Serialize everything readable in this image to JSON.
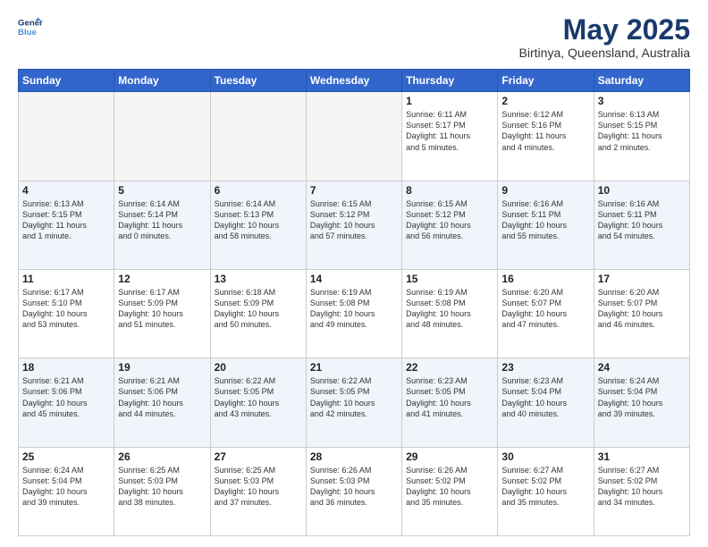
{
  "logo": {
    "line1": "General",
    "line2": "Blue"
  },
  "title": "May 2025",
  "location": "Birtinya, Queensland, Australia",
  "weekdays": [
    "Sunday",
    "Monday",
    "Tuesday",
    "Wednesday",
    "Thursday",
    "Friday",
    "Saturday"
  ],
  "weeks": [
    [
      {
        "day": "",
        "info": ""
      },
      {
        "day": "",
        "info": ""
      },
      {
        "day": "",
        "info": ""
      },
      {
        "day": "",
        "info": ""
      },
      {
        "day": "1",
        "info": "Sunrise: 6:11 AM\nSunset: 5:17 PM\nDaylight: 11 hours\nand 5 minutes."
      },
      {
        "day": "2",
        "info": "Sunrise: 6:12 AM\nSunset: 5:16 PM\nDaylight: 11 hours\nand 4 minutes."
      },
      {
        "day": "3",
        "info": "Sunrise: 6:13 AM\nSunset: 5:15 PM\nDaylight: 11 hours\nand 2 minutes."
      }
    ],
    [
      {
        "day": "4",
        "info": "Sunrise: 6:13 AM\nSunset: 5:15 PM\nDaylight: 11 hours\nand 1 minute."
      },
      {
        "day": "5",
        "info": "Sunrise: 6:14 AM\nSunset: 5:14 PM\nDaylight: 11 hours\nand 0 minutes."
      },
      {
        "day": "6",
        "info": "Sunrise: 6:14 AM\nSunset: 5:13 PM\nDaylight: 10 hours\nand 58 minutes."
      },
      {
        "day": "7",
        "info": "Sunrise: 6:15 AM\nSunset: 5:12 PM\nDaylight: 10 hours\nand 57 minutes."
      },
      {
        "day": "8",
        "info": "Sunrise: 6:15 AM\nSunset: 5:12 PM\nDaylight: 10 hours\nand 56 minutes."
      },
      {
        "day": "9",
        "info": "Sunrise: 6:16 AM\nSunset: 5:11 PM\nDaylight: 10 hours\nand 55 minutes."
      },
      {
        "day": "10",
        "info": "Sunrise: 6:16 AM\nSunset: 5:11 PM\nDaylight: 10 hours\nand 54 minutes."
      }
    ],
    [
      {
        "day": "11",
        "info": "Sunrise: 6:17 AM\nSunset: 5:10 PM\nDaylight: 10 hours\nand 53 minutes."
      },
      {
        "day": "12",
        "info": "Sunrise: 6:17 AM\nSunset: 5:09 PM\nDaylight: 10 hours\nand 51 minutes."
      },
      {
        "day": "13",
        "info": "Sunrise: 6:18 AM\nSunset: 5:09 PM\nDaylight: 10 hours\nand 50 minutes."
      },
      {
        "day": "14",
        "info": "Sunrise: 6:19 AM\nSunset: 5:08 PM\nDaylight: 10 hours\nand 49 minutes."
      },
      {
        "day": "15",
        "info": "Sunrise: 6:19 AM\nSunset: 5:08 PM\nDaylight: 10 hours\nand 48 minutes."
      },
      {
        "day": "16",
        "info": "Sunrise: 6:20 AM\nSunset: 5:07 PM\nDaylight: 10 hours\nand 47 minutes."
      },
      {
        "day": "17",
        "info": "Sunrise: 6:20 AM\nSunset: 5:07 PM\nDaylight: 10 hours\nand 46 minutes."
      }
    ],
    [
      {
        "day": "18",
        "info": "Sunrise: 6:21 AM\nSunset: 5:06 PM\nDaylight: 10 hours\nand 45 minutes."
      },
      {
        "day": "19",
        "info": "Sunrise: 6:21 AM\nSunset: 5:06 PM\nDaylight: 10 hours\nand 44 minutes."
      },
      {
        "day": "20",
        "info": "Sunrise: 6:22 AM\nSunset: 5:05 PM\nDaylight: 10 hours\nand 43 minutes."
      },
      {
        "day": "21",
        "info": "Sunrise: 6:22 AM\nSunset: 5:05 PM\nDaylight: 10 hours\nand 42 minutes."
      },
      {
        "day": "22",
        "info": "Sunrise: 6:23 AM\nSunset: 5:05 PM\nDaylight: 10 hours\nand 41 minutes."
      },
      {
        "day": "23",
        "info": "Sunrise: 6:23 AM\nSunset: 5:04 PM\nDaylight: 10 hours\nand 40 minutes."
      },
      {
        "day": "24",
        "info": "Sunrise: 6:24 AM\nSunset: 5:04 PM\nDaylight: 10 hours\nand 39 minutes."
      }
    ],
    [
      {
        "day": "25",
        "info": "Sunrise: 6:24 AM\nSunset: 5:04 PM\nDaylight: 10 hours\nand 39 minutes."
      },
      {
        "day": "26",
        "info": "Sunrise: 6:25 AM\nSunset: 5:03 PM\nDaylight: 10 hours\nand 38 minutes."
      },
      {
        "day": "27",
        "info": "Sunrise: 6:25 AM\nSunset: 5:03 PM\nDaylight: 10 hours\nand 37 minutes."
      },
      {
        "day": "28",
        "info": "Sunrise: 6:26 AM\nSunset: 5:03 PM\nDaylight: 10 hours\nand 36 minutes."
      },
      {
        "day": "29",
        "info": "Sunrise: 6:26 AM\nSunset: 5:02 PM\nDaylight: 10 hours\nand 35 minutes."
      },
      {
        "day": "30",
        "info": "Sunrise: 6:27 AM\nSunset: 5:02 PM\nDaylight: 10 hours\nand 35 minutes."
      },
      {
        "day": "31",
        "info": "Sunrise: 6:27 AM\nSunset: 5:02 PM\nDaylight: 10 hours\nand 34 minutes."
      }
    ]
  ]
}
